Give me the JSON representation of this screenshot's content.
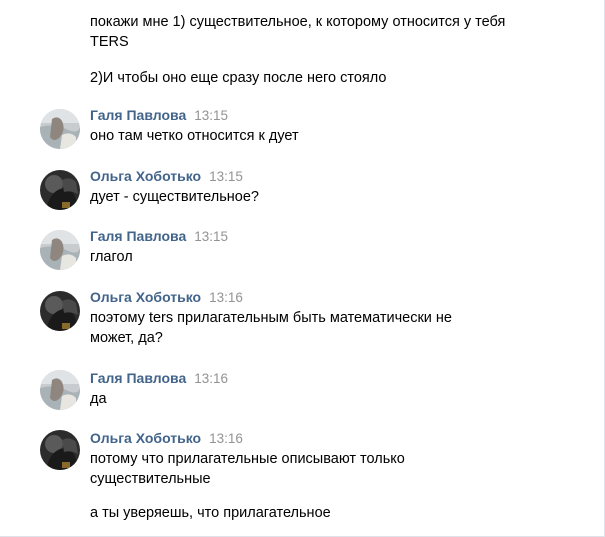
{
  "continuation": {
    "paragraphs": [
      "покажи мне 1) существительное, к которому относится у тебя TERS",
      "2)И чтобы оно еще сразу после него стояло"
    ]
  },
  "messages": [
    {
      "author": "Галя Павлова",
      "time": "13:15",
      "avatar": "galya-avatar",
      "paragraphs": [
        "оно там четко относится к дует"
      ]
    },
    {
      "author": "Ольга Хоботько",
      "time": "13:15",
      "avatar": "olga-avatar",
      "paragraphs": [
        "дует - существительное?"
      ]
    },
    {
      "author": "Галя Павлова",
      "time": "13:15",
      "avatar": "galya-avatar",
      "paragraphs": [
        "глагол"
      ]
    },
    {
      "author": "Ольга Хоботько",
      "time": "13:16",
      "avatar": "olga-avatar",
      "paragraphs": [
        "поэтому ters прилагательным быть математически не может, да?"
      ]
    },
    {
      "author": "Галя Павлова",
      "time": "13:16",
      "avatar": "galya-avatar",
      "paragraphs": [
        "да"
      ]
    },
    {
      "author": "Ольга Хоботько",
      "time": "13:16",
      "avatar": "olga-avatar",
      "paragraphs": [
        "потому что прилагательные описывают только существительные",
        "а ты уверяешь, что прилагательное"
      ]
    }
  ],
  "colors": {
    "author": "#42648b",
    "time": "#939393",
    "border": "#dfe2e8"
  }
}
